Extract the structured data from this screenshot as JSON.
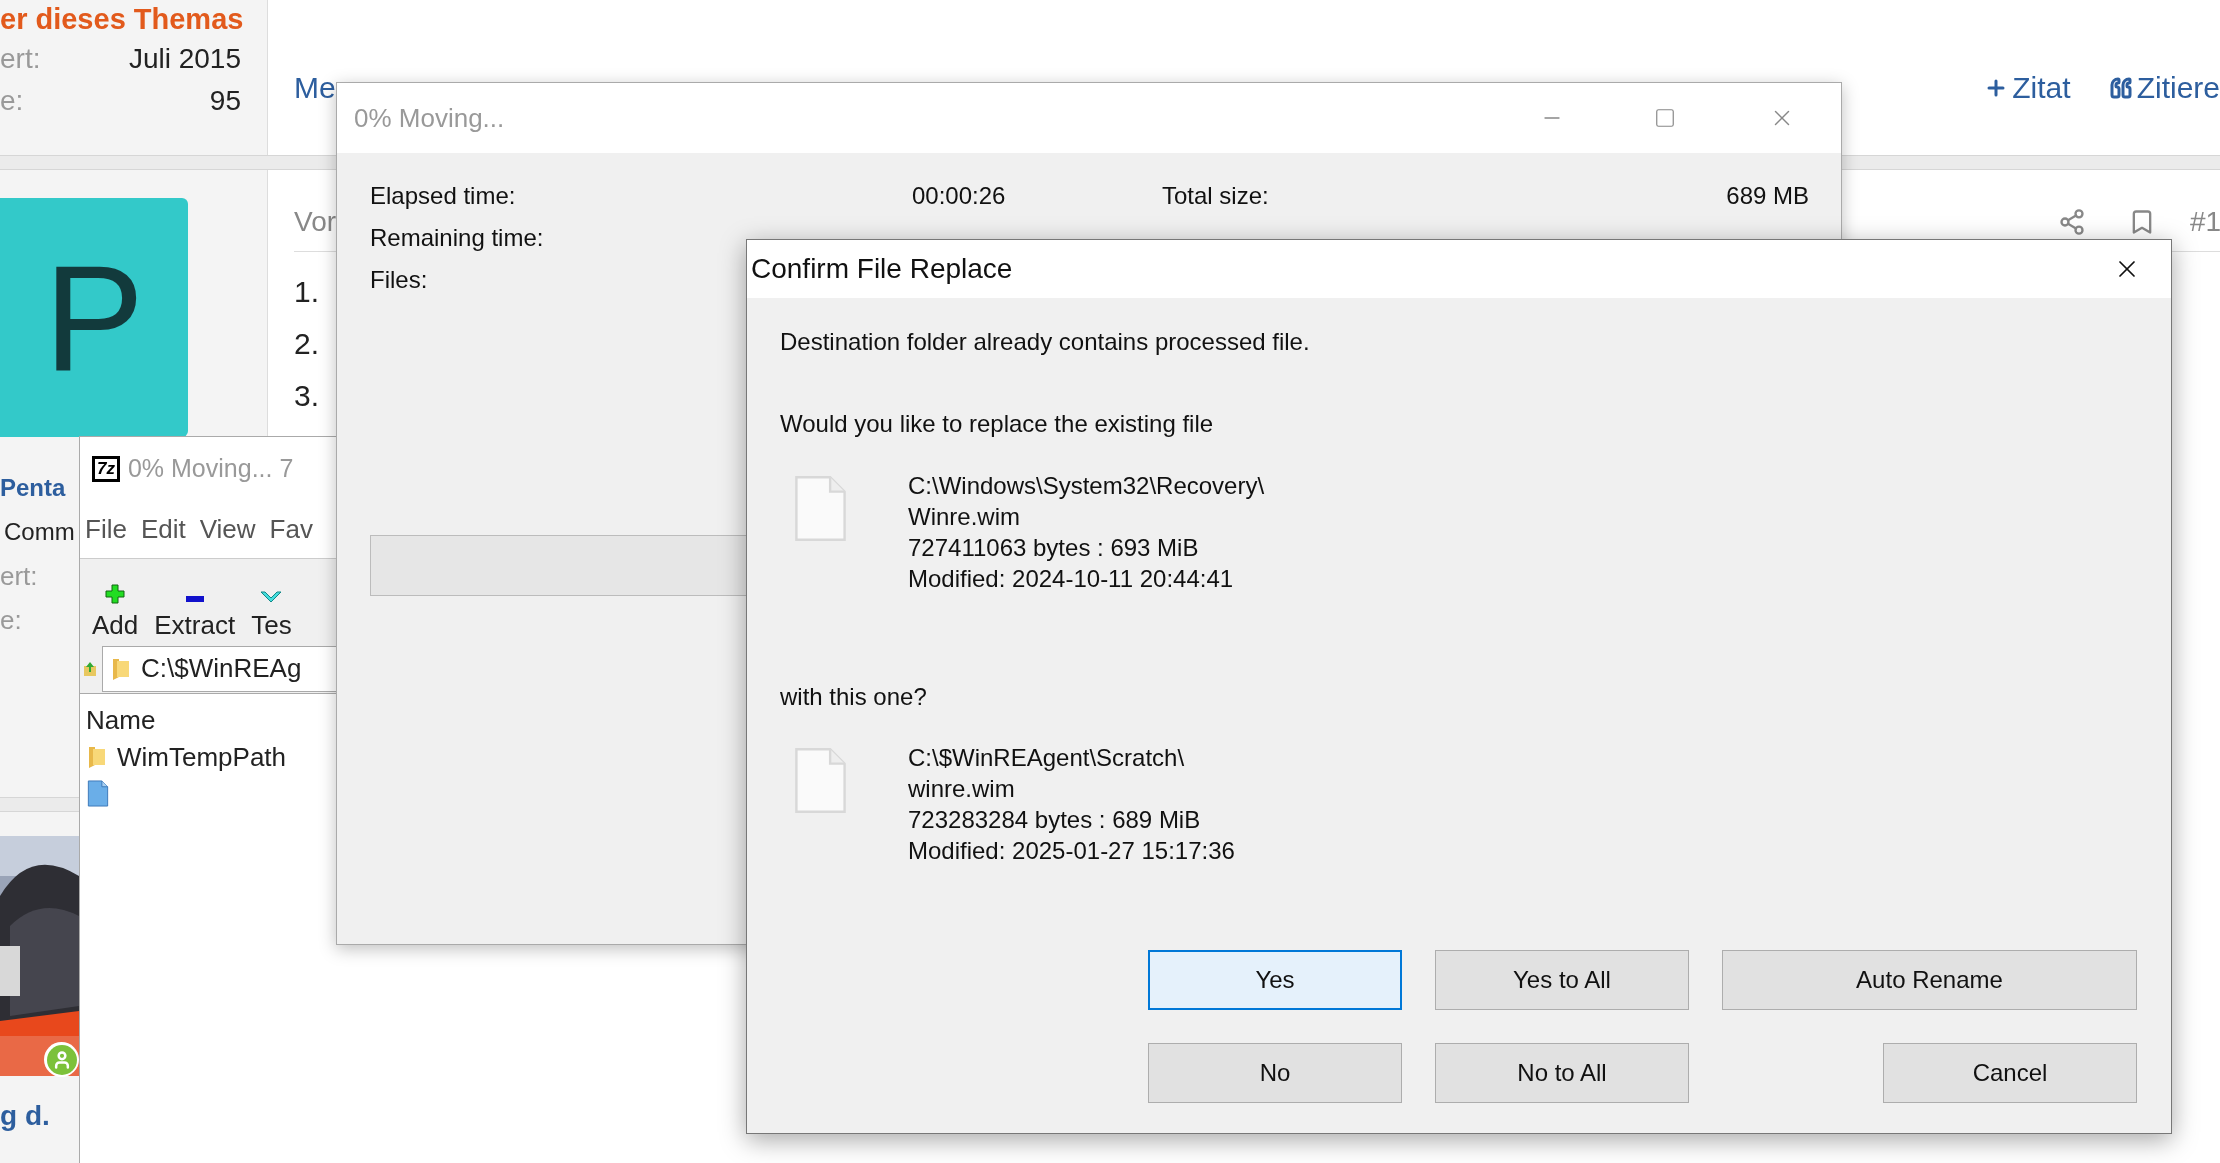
{
  "forum": {
    "thread_info": {
      "heading": "er dieses Themas",
      "rows": [
        {
          "label": "ert:",
          "value": "Juli 2015"
        },
        {
          "label": "e:",
          "value": "95"
        }
      ]
    },
    "top_link": "Me",
    "actions": [
      {
        "kind": "add",
        "label": "Zitat"
      },
      {
        "kind": "quote",
        "label": "Zitiere"
      }
    ],
    "post": {
      "author_initial": "P",
      "author_name": "Penta",
      "author_rank": "Comm",
      "author_stats": [
        "ert:",
        "e:"
      ],
      "heading": "Vor",
      "list": [
        "1.",
        "2.",
        "3."
      ],
      "post_number": "#1"
    },
    "next_post": {
      "author_name": "g d."
    }
  },
  "archive_window": {
    "app_logo": "7z",
    "title": "0% Moving... 7",
    "menu": [
      "File",
      "Edit",
      "View",
      "Fav"
    ],
    "toolbar": [
      {
        "kind": "add",
        "label": "Add"
      },
      {
        "kind": "extract",
        "label": "Extract"
      },
      {
        "kind": "test",
        "label": "Tes"
      }
    ],
    "address": "C:\\$WinREAg",
    "column": "Name",
    "rows": [
      {
        "kind": "folder",
        "name": "WimTempPath"
      },
      {
        "kind": "file"
      }
    ]
  },
  "progress_window": {
    "title": "0% Moving...",
    "stats": [
      {
        "label": "Elapsed time:",
        "value": "00:00:26",
        "label_2": "Total size:",
        "value_2": "689 MB"
      },
      {
        "label": "Remaining time:"
      },
      {
        "label": "Files:"
      }
    ],
    "progress": {
      "level": 0
    }
  },
  "confirm_dialog": {
    "title": "Confirm File Replace",
    "message": "Destination folder already contains processed file.",
    "question": "Would you like to replace the existing file",
    "existing_file": [
      "C:\\Windows\\System32\\Recovery\\",
      "Winre.wim",
      "727411063 bytes : 693 MiB",
      "Modified: 2024-10-11 20:44:41"
    ],
    "question_2": "with this one?",
    "new_file": [
      "C:\\$WinREAgent\\Scratch\\",
      "winre.wim",
      "723283284 bytes : 689 MiB",
      "Modified: 2025-01-27 15:17:36"
    ],
    "button_rows": [
      [
        {
          "label": "Yes",
          "selected": true
        },
        {
          "label": "Yes to All",
          "selected": false
        },
        {
          "label": "Auto Rename",
          "selected": false
        }
      ],
      [
        {
          "label": "No",
          "selected": false
        },
        {
          "label": "No to All",
          "selected": false
        },
        {
          "label": "Cancel",
          "selected": false
        }
      ]
    ]
  }
}
